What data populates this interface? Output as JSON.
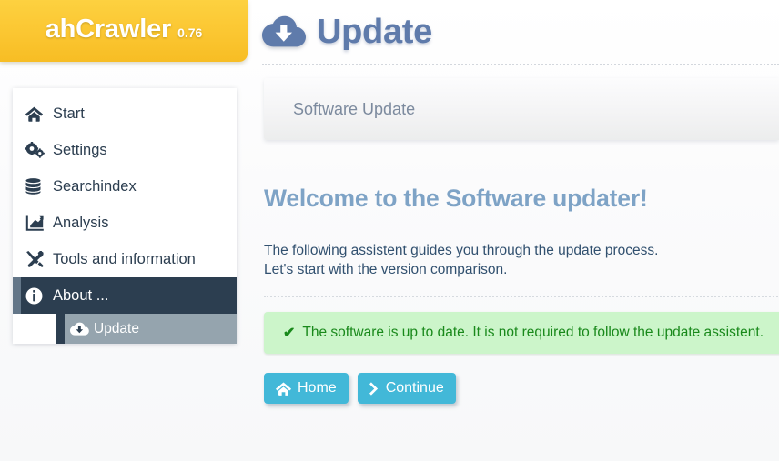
{
  "brand": {
    "name": "ahCrawler",
    "version": "0.76",
    "logo_bg": "#fbc631"
  },
  "sidebar": {
    "items": [
      {
        "label": "Start",
        "icon": "home-icon",
        "state": "normal"
      },
      {
        "label": "Settings",
        "icon": "cogs-icon",
        "state": "normal"
      },
      {
        "label": "Searchindex",
        "icon": "database-icon",
        "state": "normal"
      },
      {
        "label": "Analysis",
        "icon": "chart-line-icon",
        "state": "normal"
      },
      {
        "label": "Tools and information",
        "icon": "tools-icon",
        "state": "normal"
      },
      {
        "label": "About ...",
        "icon": "info-circle-icon",
        "state": "active"
      }
    ],
    "subitem": {
      "label": "Update",
      "icon": "cloud-download-icon",
      "state": "selected"
    },
    "active_bg": "#2c3e50",
    "subitem_bg": "#95a4ae"
  },
  "header": {
    "title": "Update",
    "icon": "cloud-download-icon",
    "color": "#5f7bab"
  },
  "tabbar": {
    "tabs": [
      {
        "label": "Software Update",
        "active": true
      }
    ]
  },
  "main": {
    "heading": "Welcome to the Software updater!",
    "heading_color": "#7ea3c6",
    "intro_line1": "The following assistent guides you through the update process.",
    "intro_line2": "Let's start with the version comparison.",
    "alert": {
      "icon": "check-icon",
      "text": "The software is up to date. It is not required to follow the update assistent.",
      "bg": "#ccf5ca",
      "color": "#19891b"
    },
    "buttons": [
      {
        "label": "Home",
        "icon": "home-icon",
        "color": "#42b8d8"
      },
      {
        "label": "Continue",
        "icon": "chevron-right-icon",
        "color": "#42b8d8"
      }
    ]
  }
}
